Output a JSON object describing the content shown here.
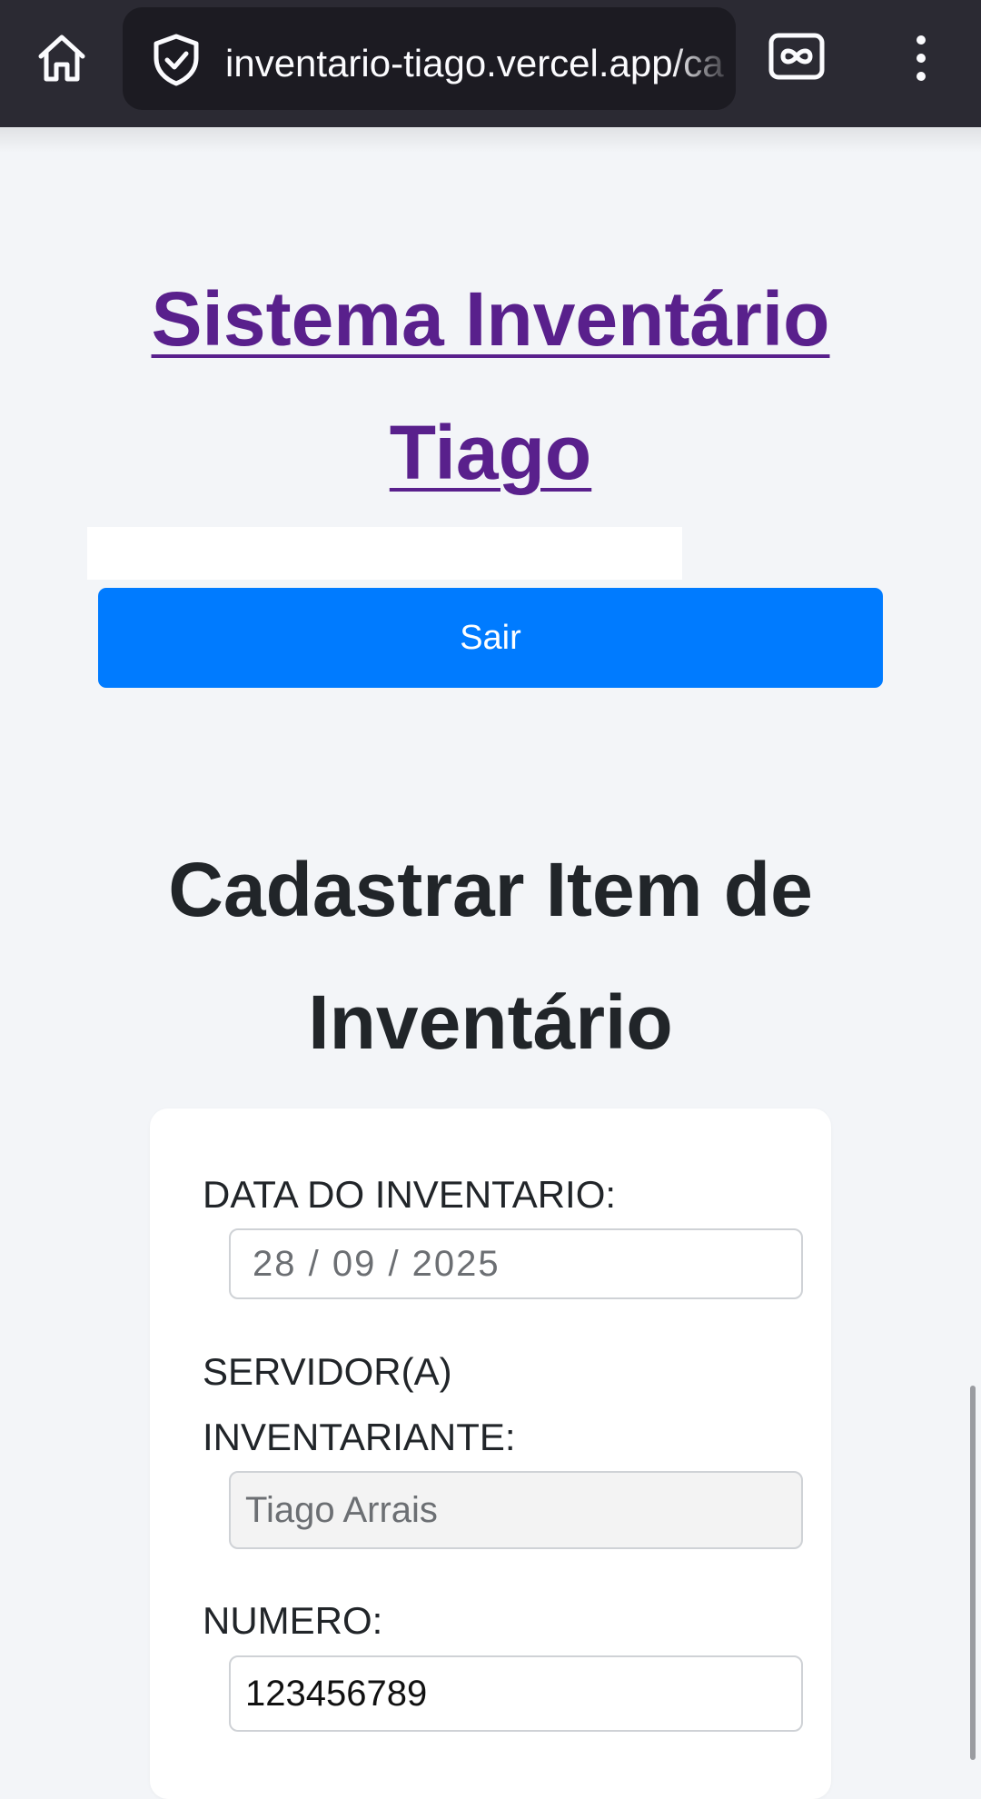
{
  "browser": {
    "url": "inventario-tiago.vercel.app/ca",
    "icons": {
      "home": "home-icon",
      "security": "shield-check-icon",
      "mode": "private-mode-icon",
      "menu": "more-vertical-icon"
    }
  },
  "header": {
    "title_line1": "Sistema Inventário",
    "title_line2": "Tiago"
  },
  "logout_button": "Sair",
  "section": {
    "title_line1": "Cadastrar Item de",
    "title_line2": "Inventário"
  },
  "form": {
    "date_label": "DATA DO INVENTARIO:",
    "date_value": "28 / 09 / 2025",
    "server_label_line1": "SERVIDOR(A)",
    "server_label_line2": "INVENTARIANTE:",
    "server_value": "Tiago Arrais",
    "number_label": "NUMERO:",
    "number_value": "123456789"
  },
  "colors": {
    "browser_bar": "#2b2a33",
    "url_box": "#1c1b22",
    "title": "#59208c",
    "button": "#007bff",
    "page_bg": "#f3f5f8"
  }
}
